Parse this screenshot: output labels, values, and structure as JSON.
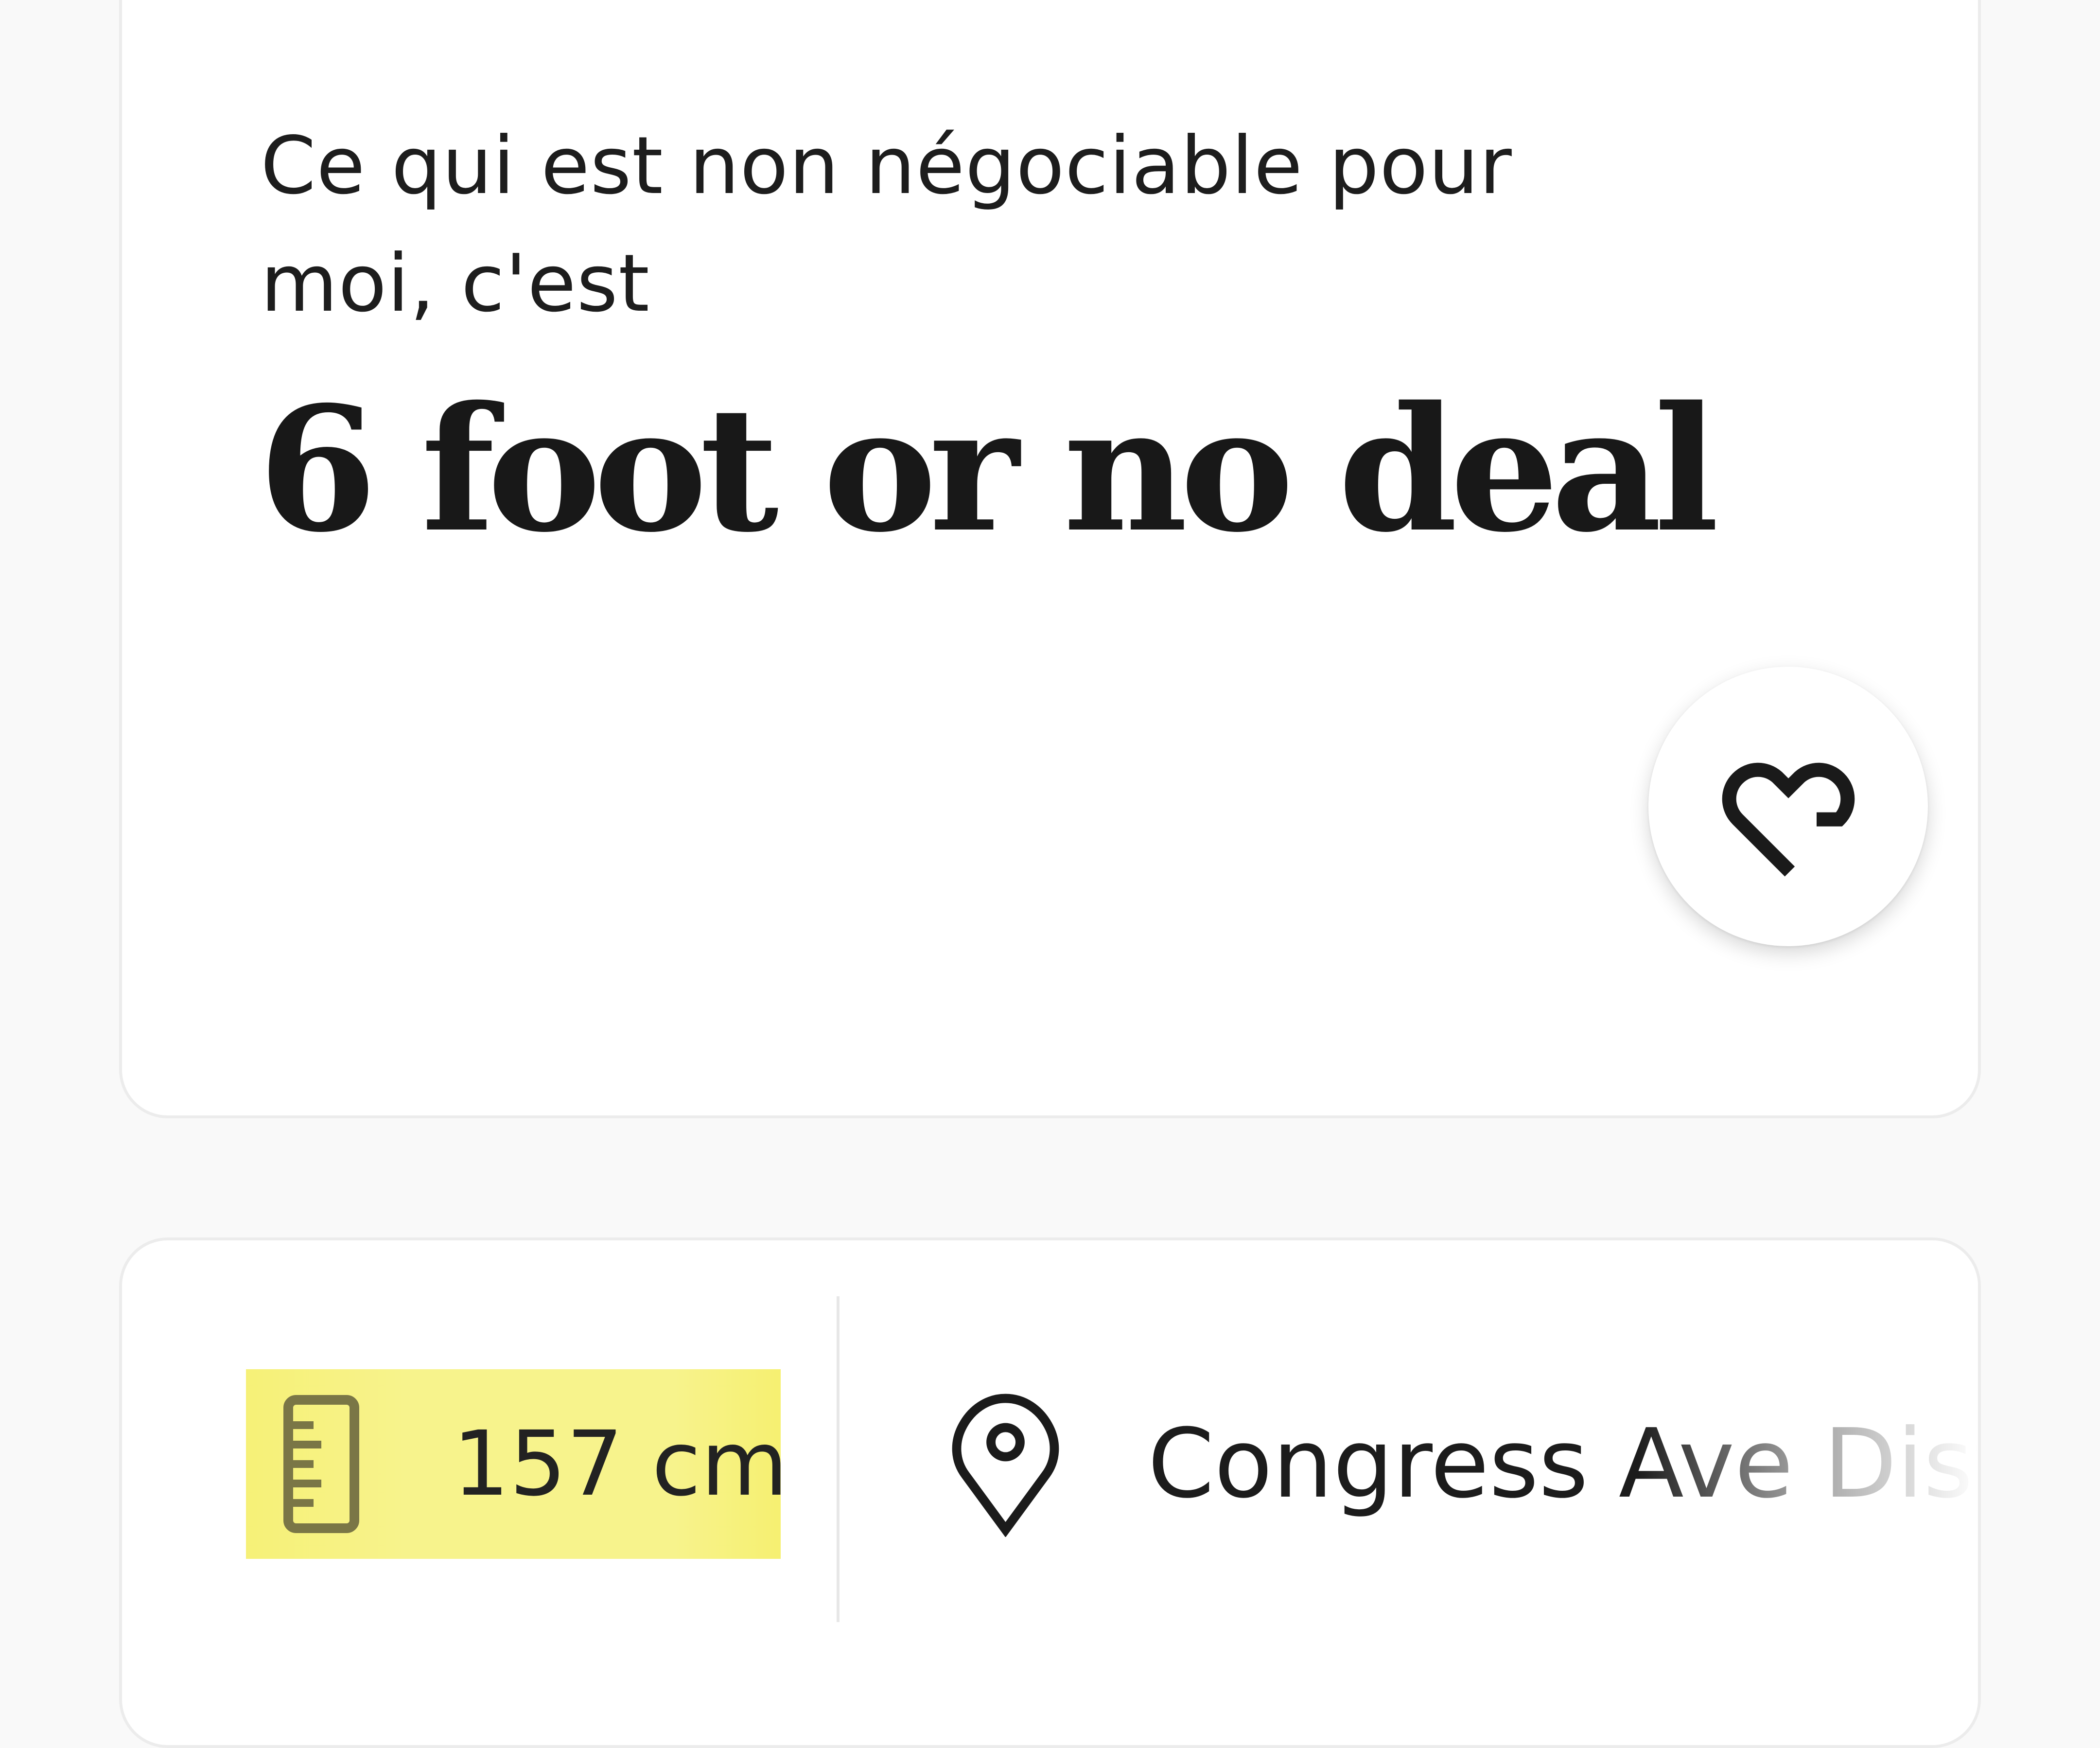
{
  "prompt_card": {
    "question": "Ce qui est non négociable pour moi, c'est",
    "answer": "6 foot or no deal",
    "like_icon": "heart-like-icon"
  },
  "info_card": {
    "height": {
      "icon": "ruler-icon",
      "value": "157 cm",
      "highlight_color": "#f7f38c"
    },
    "location": {
      "icon": "location-pin-icon",
      "value": "Congress Ave Distr"
    }
  }
}
